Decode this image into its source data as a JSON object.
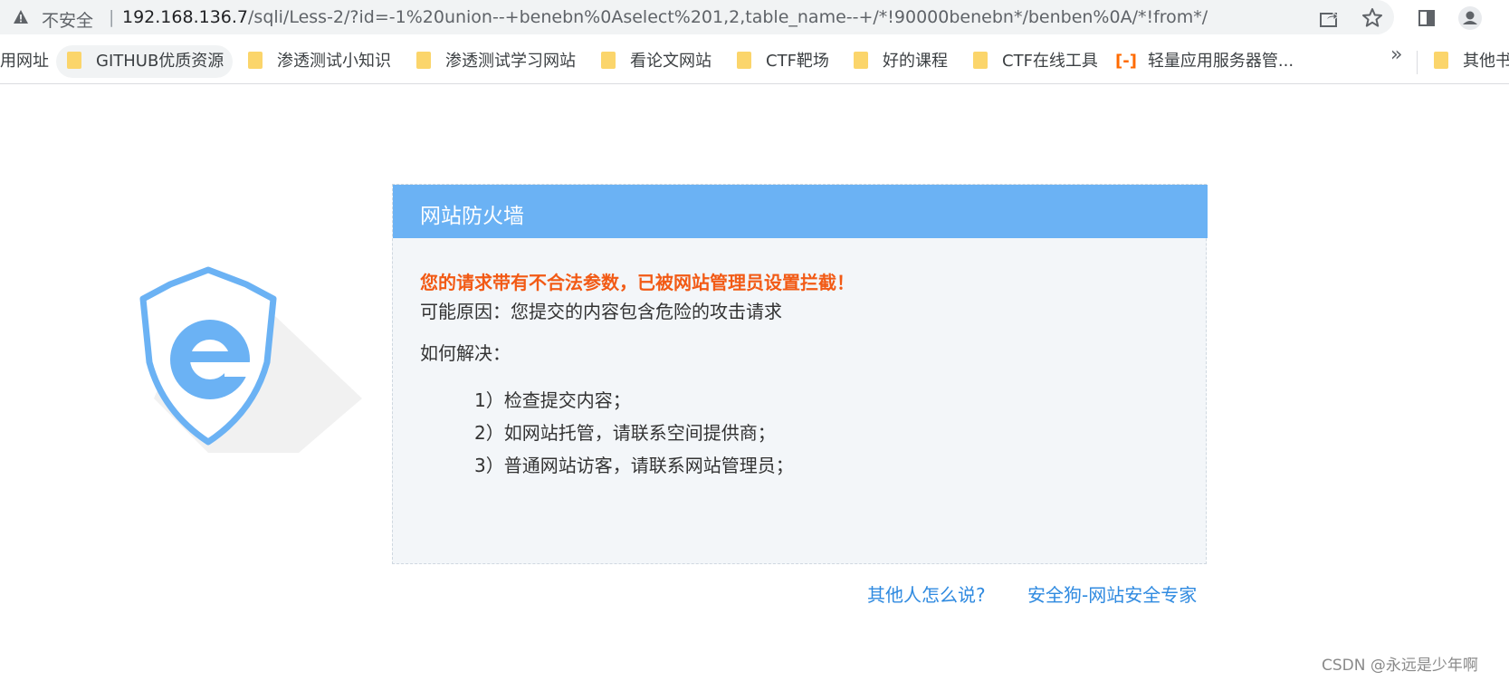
{
  "browser": {
    "security_label": "不安全",
    "separator": "|",
    "url_host": "192.168.136.7",
    "url_path": "/sqli/Less-2/?id=-1%20union--+benebn%0Aselect%201,2,table_name--+/*!90000benebn*/benben%0A/*!from*/"
  },
  "bookmarks": {
    "items": [
      {
        "label": "用网址"
      },
      {
        "label": "GITHUB优质资源"
      },
      {
        "label": "渗透测试小知识"
      },
      {
        "label": "渗透测试学习网站"
      },
      {
        "label": "看论文网站"
      },
      {
        "label": "CTF靶场"
      },
      {
        "label": "好的课程"
      },
      {
        "label": "CTF在线工具"
      },
      {
        "label": "轻量应用服务器管..."
      }
    ],
    "more": "»",
    "other": "其他书"
  },
  "firewall": {
    "title": "网站防火墙",
    "alert": "您的请求带有不合法参数，已被网站管理员设置拦截！",
    "reason": "可能原因：您提交的内容包含危险的攻击请求",
    "howto": "如何解决：",
    "steps": [
      "1）检查提交内容；",
      "2）如网站托管，请联系空间提供商；",
      "3）普通网站访客，请联系网站管理员；"
    ],
    "links": {
      "others": "其他人怎么说?",
      "safedog": "安全狗-网站安全专家"
    }
  },
  "watermark": "CSDN @永远是少年啊",
  "colors": {
    "header_blue": "#6bb2f4",
    "alert_orange": "#f25a15",
    "link_blue": "#2f8ae0",
    "panel_bg": "#f3f6f9"
  }
}
